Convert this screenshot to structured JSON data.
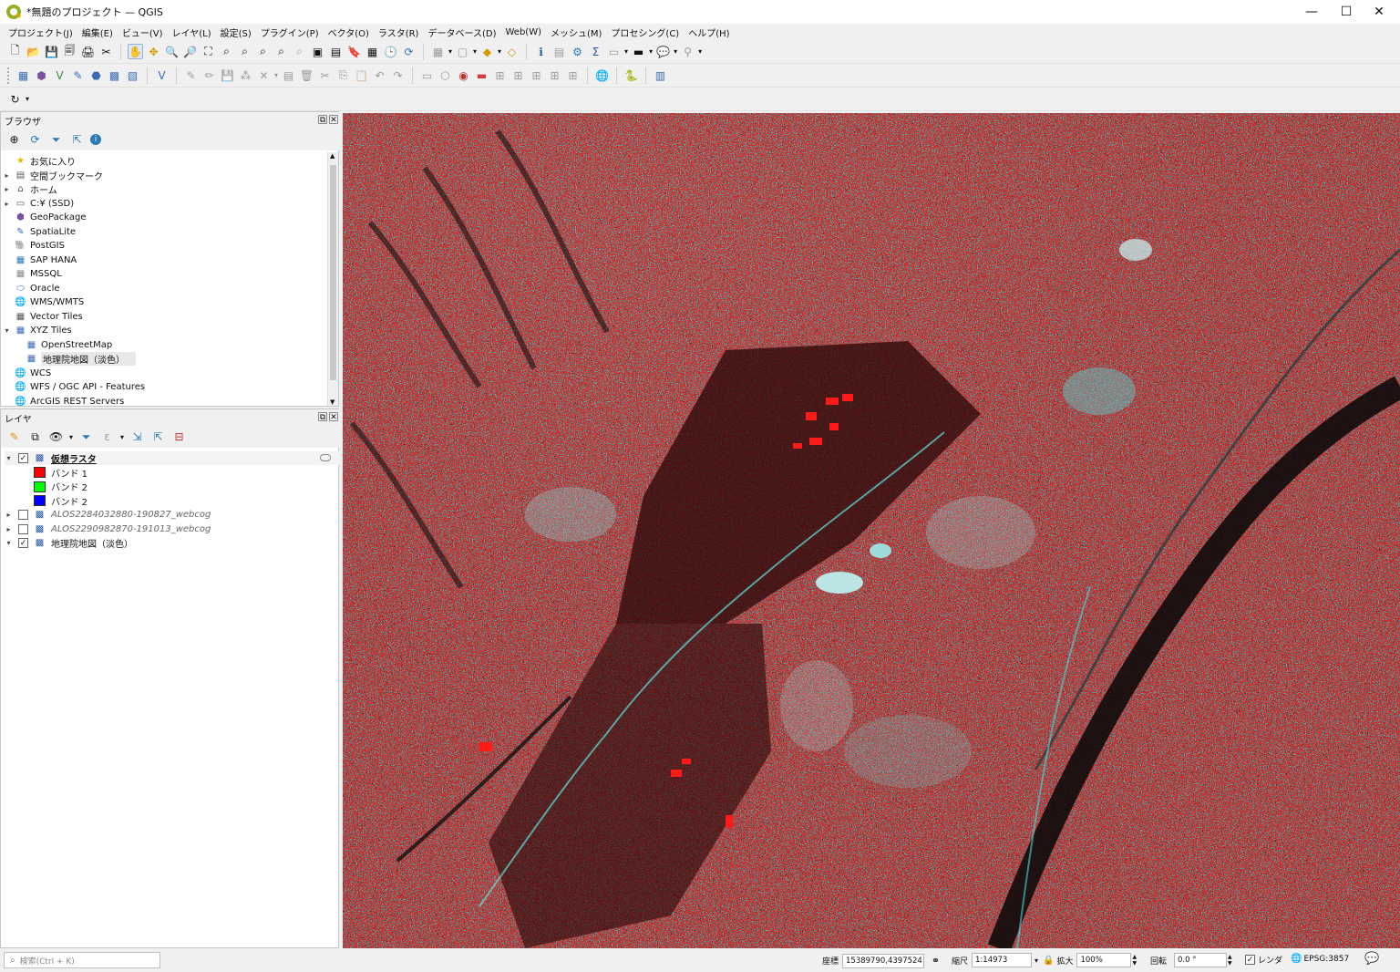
{
  "window": {
    "title": "*無題のプロジェクト — QGIS"
  },
  "menu": [
    "プロジェクト(J)",
    "編集(E)",
    "ビュー(V)",
    "レイヤ(L)",
    "設定(S)",
    "プラグイン(P)",
    "ベクタ(O)",
    "ラスタ(R)",
    "データベース(D)",
    "Web(W)",
    "メッシュ(M)",
    "プロセシング(C)",
    "ヘルプ(H)"
  ],
  "browser": {
    "title": "ブラウザ",
    "items": [
      {
        "label": "お気に入り",
        "icon": "star-icon",
        "expand": ""
      },
      {
        "label": "空間ブックマーク",
        "icon": "bookmark-icon",
        "expand": "▸"
      },
      {
        "label": "ホーム",
        "icon": "home-folder-icon",
        "expand": "▸"
      },
      {
        "label": "C:¥ (SSD)",
        "icon": "drive-icon",
        "expand": "▸"
      },
      {
        "label": "GeoPackage",
        "icon": "geopackage-icon",
        "expand": ""
      },
      {
        "label": "SpatiaLite",
        "icon": "spatialite-icon",
        "expand": ""
      },
      {
        "label": "PostGIS",
        "icon": "postgis-icon",
        "expand": ""
      },
      {
        "label": "SAP HANA",
        "icon": "sap-hana-icon",
        "expand": ""
      },
      {
        "label": "MSSQL",
        "icon": "mssql-icon",
        "expand": ""
      },
      {
        "label": "Oracle",
        "icon": "oracle-icon",
        "expand": ""
      },
      {
        "label": "WMS/WMTS",
        "icon": "wms-icon",
        "expand": ""
      },
      {
        "label": "Vector Tiles",
        "icon": "vector-tiles-icon",
        "expand": ""
      },
      {
        "label": "XYZ Tiles",
        "icon": "xyz-tiles-icon",
        "expand": "▾"
      },
      {
        "label": "OpenStreetMap",
        "icon": "tile-grid-icon",
        "expand": "",
        "indent": 1
      },
      {
        "label": "地理院地図（淡色）",
        "icon": "tile-grid-icon",
        "expand": "",
        "indent": 1,
        "selected": true
      },
      {
        "label": "WCS",
        "icon": "wcs-icon",
        "expand": ""
      },
      {
        "label": "WFS / OGC API - Features",
        "icon": "wfs-icon",
        "expand": ""
      },
      {
        "label": "ArcGIS REST Servers",
        "icon": "arcgis-icon",
        "expand": ""
      }
    ]
  },
  "layers": {
    "title": "レイヤ",
    "items": [
      {
        "label": "仮想ラスタ",
        "checked": true,
        "expand": "▾",
        "bold": true,
        "italic": false
      },
      {
        "label": "バンド 1",
        "swatch": "#ff0000"
      },
      {
        "label": "バンド 2",
        "swatch": "#00ff00"
      },
      {
        "label": "バンド 2",
        "swatch": "#0000ff"
      },
      {
        "label": "ALOS2284032880-190827_webcog",
        "checked": false,
        "expand": "▸",
        "italic": true
      },
      {
        "label": "ALOS2290982870-191013_webcog",
        "checked": false,
        "expand": "▸",
        "italic": true
      },
      {
        "label": "地理院地図（淡色）",
        "checked": true,
        "expand": "▾",
        "italic": false
      }
    ]
  },
  "status": {
    "search_placeholder": "検索(Ctrl + K)",
    "coord_label": "座標",
    "coord_value": "15389790,4397524",
    "scale_label": "縮尺",
    "scale_value": "1:14973",
    "magnifier_label": "拡大",
    "magnifier_value": "100%",
    "rotation_label": "回転",
    "rotation_value": "0.0 °",
    "render_label": "レンダ",
    "crs": "EPSG:3857"
  },
  "map": {
    "description_colors": [
      "#ff2020",
      "#20e6e6",
      "#ffffff"
    ]
  }
}
